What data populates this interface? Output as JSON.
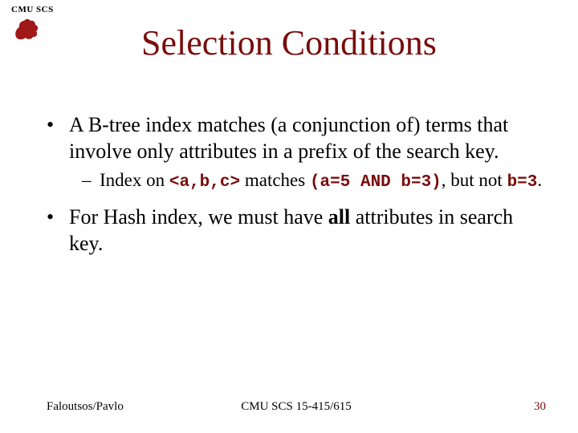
{
  "header": {
    "label": "CMU SCS"
  },
  "title": "Selection Conditions",
  "bullets": {
    "b1": "A B-tree index matches (a conjunction of) terms that involve only attributes in a prefix of the search key.",
    "b1sub_pre": "Index on ",
    "b1sub_code1": "<a,b,c>",
    "b1sub_mid": " matches ",
    "b1sub_code2": "(a=5 AND b=3)",
    "b1sub_post1": ", but not ",
    "b1sub_code3": "b=3",
    "b1sub_post2": ".",
    "b2_pre": "For Hash index, we must have ",
    "b2_bold": "all",
    "b2_post": " attributes in search key."
  },
  "footer": {
    "left": "Faloutsos/Pavlo",
    "center": "CMU SCS 15-415/615",
    "right": "30"
  }
}
